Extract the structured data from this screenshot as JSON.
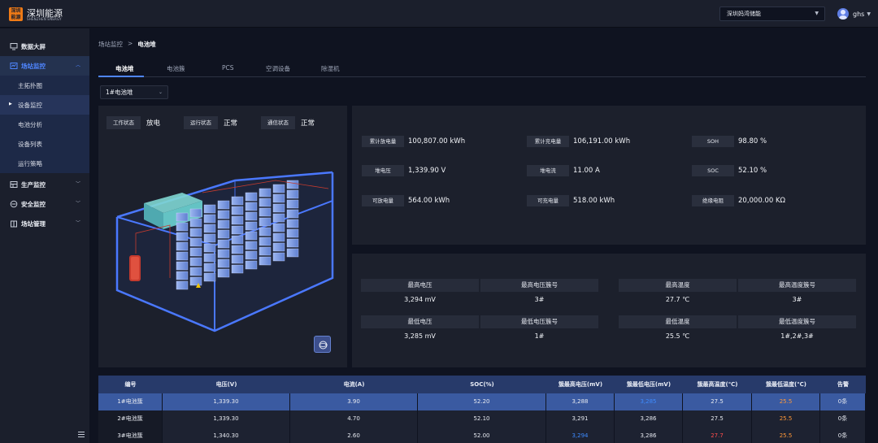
{
  "app": {
    "brand": "深圳能源",
    "brand_sub": "SHENZHEN ENERGY",
    "logo_text": "深圳能源",
    "site_select": "深圳妈湾储能",
    "user": "ghs"
  },
  "sidebar": {
    "items": [
      {
        "label": "数据大屏",
        "icon": "monitor-icon"
      },
      {
        "label": "场站监控",
        "icon": "station-monitor-icon"
      },
      {
        "label": "主拓扑图"
      },
      {
        "label": "设备监控"
      },
      {
        "label": "电池分析"
      },
      {
        "label": "设备列表"
      },
      {
        "label": "运行策略"
      },
      {
        "label": "生产监控",
        "icon": "production-icon"
      },
      {
        "label": "安全监控",
        "icon": "shield-icon"
      },
      {
        "label": "场站管理",
        "icon": "building-icon"
      }
    ]
  },
  "breadcrumb": {
    "root": "场站监控",
    "sep": ">",
    "current": "电池堆"
  },
  "tabs": [
    "电池堆",
    "电池簇",
    "PCS",
    "空调设备",
    "除湿机"
  ],
  "stack_select": "1#电池堆",
  "status": {
    "work_label": "工作状态",
    "work_value": "放电",
    "run_label": "运行状态",
    "run_value": "正常",
    "comm_label": "通信状态",
    "comm_value": "正常"
  },
  "metrics": [
    {
      "label": "累计放电量",
      "value": "100,807.00 kWh"
    },
    {
      "label": "累计充电量",
      "value": "106,191.00 kWh"
    },
    {
      "label": "SOH",
      "value": "98.80 %"
    },
    {
      "label": "堆电压",
      "value": "1,339.90 V"
    },
    {
      "label": "堆电流",
      "value": "11.00 A"
    },
    {
      "label": "SOC",
      "value": "52.10 %"
    },
    {
      "label": "可放电量",
      "value": "564.00 kWh"
    },
    {
      "label": "可充电量",
      "value": "518.00 kWh"
    },
    {
      "label": "绝缘电阻",
      "value": "20,000.00 KΩ"
    }
  ],
  "extremes": {
    "headers": [
      "最高电压",
      "最高电压簇号",
      "最高温度",
      "最高温度簇号",
      "最低电压",
      "最低电压簇号",
      "最低温度",
      "最低温度簇号"
    ],
    "values": [
      "3,294 mV",
      "3#",
      "27.7 ℃",
      "3#",
      "3,285 mV",
      "1#",
      "25.5 ℃",
      "1#,2#,3#"
    ]
  },
  "table": {
    "headers": [
      "编号",
      "电压(V)",
      "电流(A)",
      "SOC(%)",
      "簇最高电压(mV)",
      "簇最低电压(mV)",
      "簇最高温度(℃)",
      "簇最低温度(℃)",
      "告警"
    ],
    "rows": [
      [
        "1#电池簇",
        "1,339.30",
        "3.90",
        "52.20",
        "3,288",
        "3,285",
        "27.5",
        "25.5",
        "0条"
      ],
      [
        "2#电池簇",
        "1,339.30",
        "4.70",
        "52.10",
        "3,291",
        "3,286",
        "27.5",
        "25.5",
        "0条"
      ],
      [
        "3#电池簇",
        "1,340.30",
        "2.60",
        "52.00",
        "3,294",
        "3,286",
        "27.7",
        "25.5",
        "0条"
      ]
    ]
  },
  "colors": {
    "accent": "#4f86ff",
    "highlight_row": "#3a5aa1",
    "warn": "#ff9838",
    "alert": "#ff4d4d",
    "info": "#3d8bff"
  }
}
